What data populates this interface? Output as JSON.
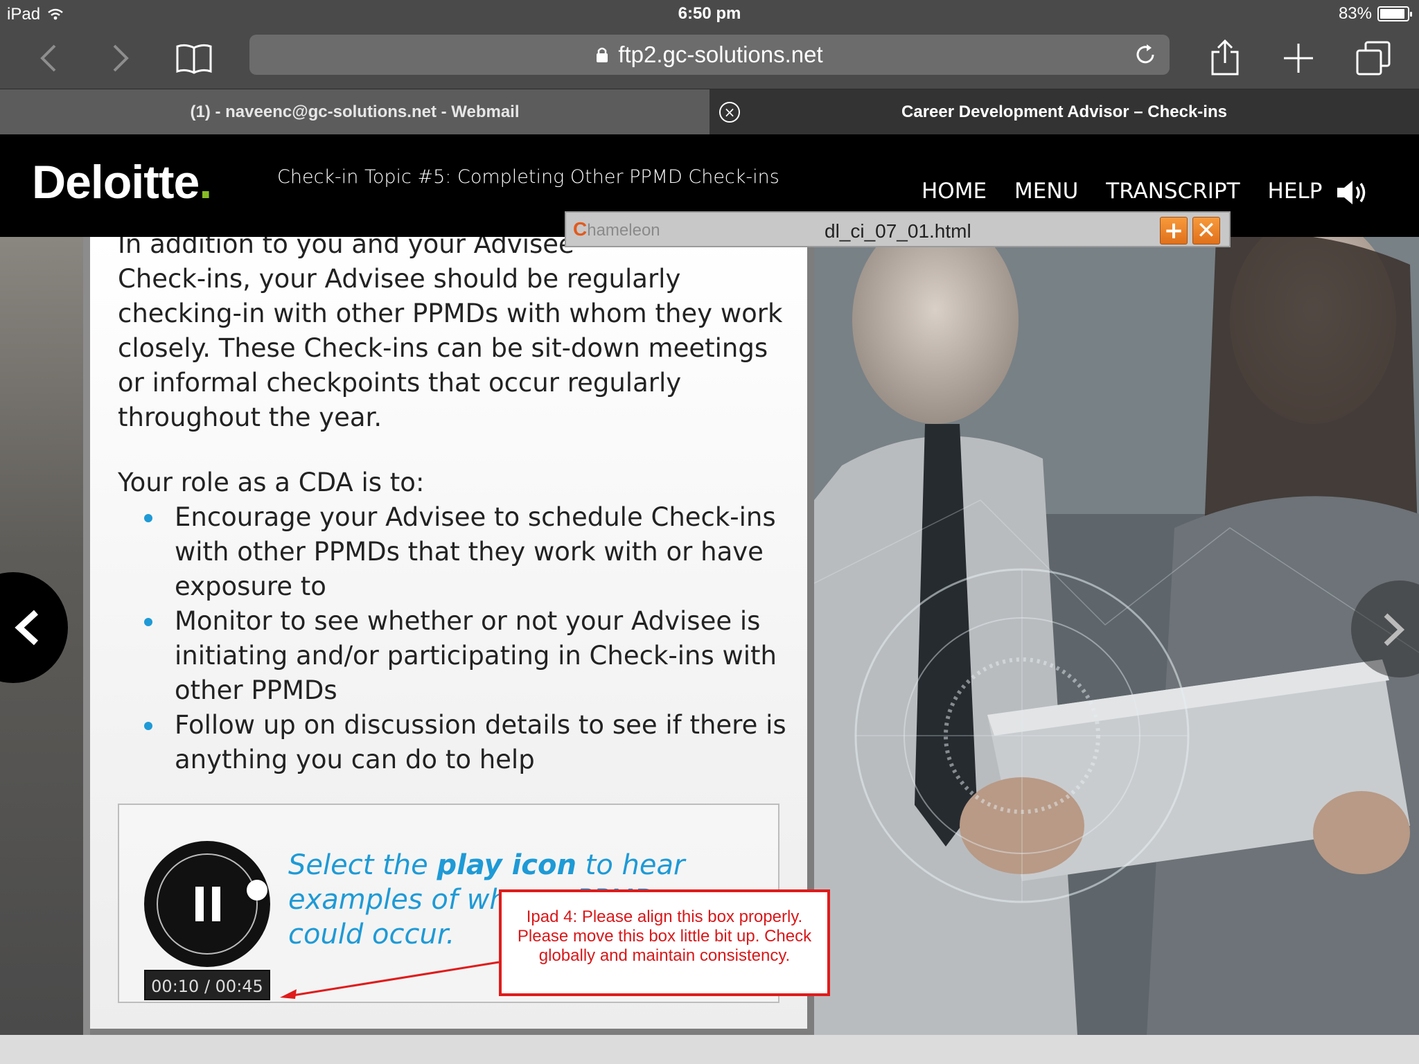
{
  "status_bar": {
    "device": "iPad",
    "time": "6:50 pm",
    "battery": "83%"
  },
  "browser": {
    "url": "ftp2.gc-solutions.net",
    "tabs": [
      {
        "label": "(1) - naveenc@gc-solutions.net - Webmail"
      },
      {
        "label": "Career Development Advisor – Check-ins"
      }
    ]
  },
  "header": {
    "logo": "Deloitte",
    "logo_dot": ".",
    "topic": "Check-in Topic #5: Completing Other PPMD Check-ins",
    "nav": [
      "HOME",
      "MENU",
      "TRANSCRIPT",
      "HELP"
    ]
  },
  "content": {
    "paragraph_first": "In addition to you and your Advisee",
    "paragraph": "Check-ins, your Advisee should be regularly checking-in with other PPMDs with whom they work closely. These Check-ins can be sit-down meetings or informal checkpoints that occur regularly throughout the year.",
    "role_heading": "Your role as a CDA is to:",
    "bullets": [
      "Encourage your Advisee to schedule Check-ins with other PPMDs that they work with or have exposure to",
      "Monitor to see whether or not your Advisee is initiating and/or participating in Check-ins with other PPMDs",
      "Follow up on discussion details to see if there is anything you can do to help"
    ],
    "audio": {
      "prompt_before": "Select the ",
      "prompt_bold": "play icon",
      "prompt_after": " to hear examples of when a PPMD",
      "prompt_end": "could occur.",
      "timer": "00:10 / 00:45",
      "progress": 0.22
    }
  },
  "annotation": {
    "text": "Ipad 4: Please align this box properly. Please move this box little bit up. Check globally and maintain consistency.",
    "color": "#e01b1b"
  },
  "chameleon": {
    "logo_c": "C",
    "logo_rest": "hameleon",
    "filename": "dl_ci_07_01.html"
  },
  "colors": {
    "accent": "#1e9ad6",
    "brand_green": "#86bc25",
    "annotation_red": "#e01b1b"
  }
}
